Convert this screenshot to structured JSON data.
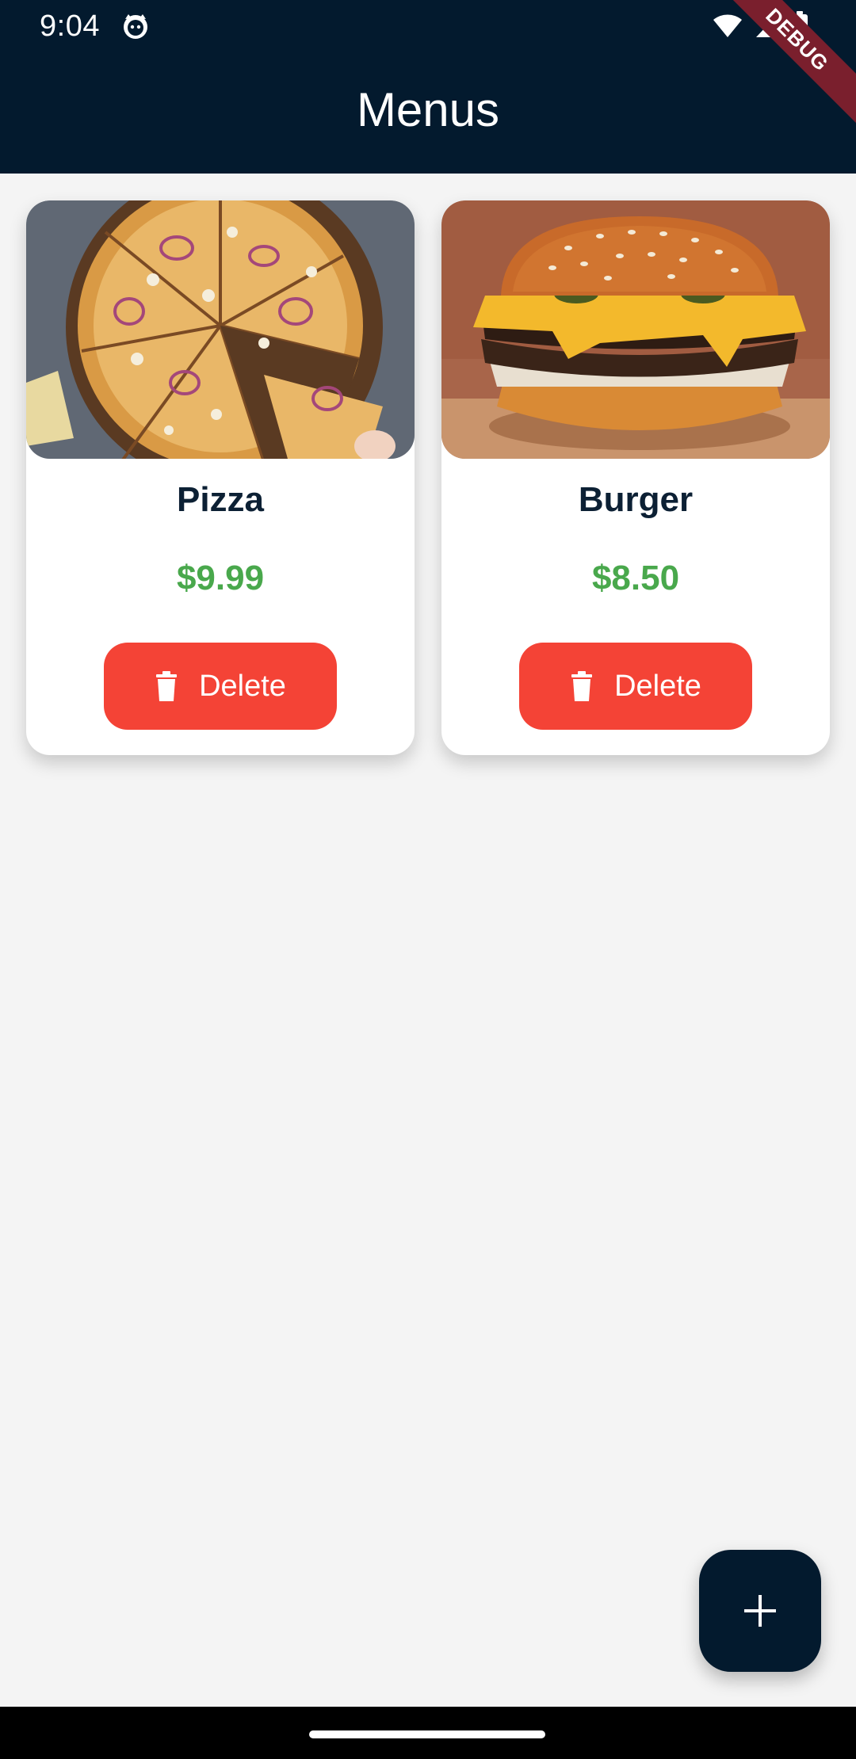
{
  "status_bar": {
    "time": "9:04"
  },
  "app_bar": {
    "title": "Menus",
    "debug_label": "DEBUG"
  },
  "menu_items": [
    {
      "name": "Pizza",
      "price": "$9.99",
      "delete_label": "Delete"
    },
    {
      "name": "Burger",
      "price": "$8.50",
      "delete_label": "Delete"
    }
  ],
  "colors": {
    "appbar": "#031a2e",
    "price": "#49a84c",
    "delete": "#f44336",
    "fab": "#031a2e",
    "background": "#f4f4f4"
  },
  "icons": {
    "delete": "trash-icon",
    "fab": "plus-icon",
    "status": [
      "cat-app-icon",
      "wifi-icon",
      "signal-icon",
      "battery-icon"
    ]
  }
}
